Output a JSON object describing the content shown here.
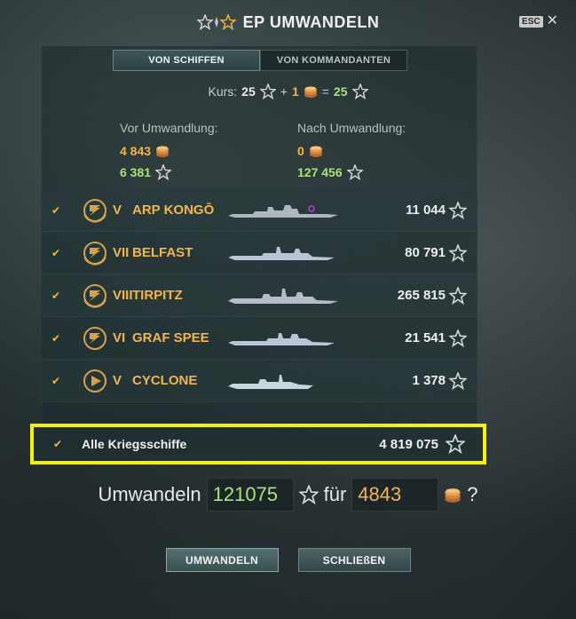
{
  "header": {
    "title": "EP UMWANDELN",
    "esc_label": "ESC",
    "close_glyph": "✕"
  },
  "tabs": [
    {
      "label": "VON SCHIFFEN",
      "active": true
    },
    {
      "label": "VON KOMMANDANTEN",
      "active": false
    }
  ],
  "rate": {
    "label": "Kurs:",
    "xp_amount": "25",
    "plus": "+",
    "gold_amount": "1",
    "equals": "=",
    "result": "25"
  },
  "conversion": {
    "before_label": "Vor Umwandlung:",
    "after_label": "Nach Umwandlung:",
    "before_gold": "4 843",
    "before_xp": "6 381",
    "after_gold": "0",
    "after_xp": "127 456"
  },
  "ships": [
    {
      "tier": "V",
      "name": "ARP KONGŌ",
      "xp": "11 044",
      "check": "✔"
    },
    {
      "tier": "VII",
      "name": "BELFAST",
      "xp": "80 791",
      "check": "✔"
    },
    {
      "tier": "VIII",
      "name": "TIRPITZ",
      "xp": "265 815",
      "check": "✔"
    },
    {
      "tier": "VI",
      "name": "GRAF SPEE",
      "xp": "21 541",
      "check": "✔"
    },
    {
      "tier": "V",
      "name": "CYCLONE",
      "xp": "1 378",
      "check": "✔"
    }
  ],
  "all_ships": {
    "label": "Alle Kriegsschiffe",
    "xp": "4 819 075",
    "check": "✔"
  },
  "convert": {
    "prefix": "Umwandeln",
    "xp_value": "121075",
    "for_label": "für",
    "gold_value": "4843",
    "question": "?"
  },
  "buttons": {
    "convert_label": "UMWANDELN",
    "close_label": "SCHLIEßEN"
  },
  "colors": {
    "gold": "#f0b64c",
    "green": "#a9e27a",
    "highlight": "#f4f10d"
  },
  "icons": [
    "star-icon",
    "free-xp-icon",
    "doubloon-icon",
    "elite-emblem-icon",
    "check-icon",
    "close-icon"
  ]
}
